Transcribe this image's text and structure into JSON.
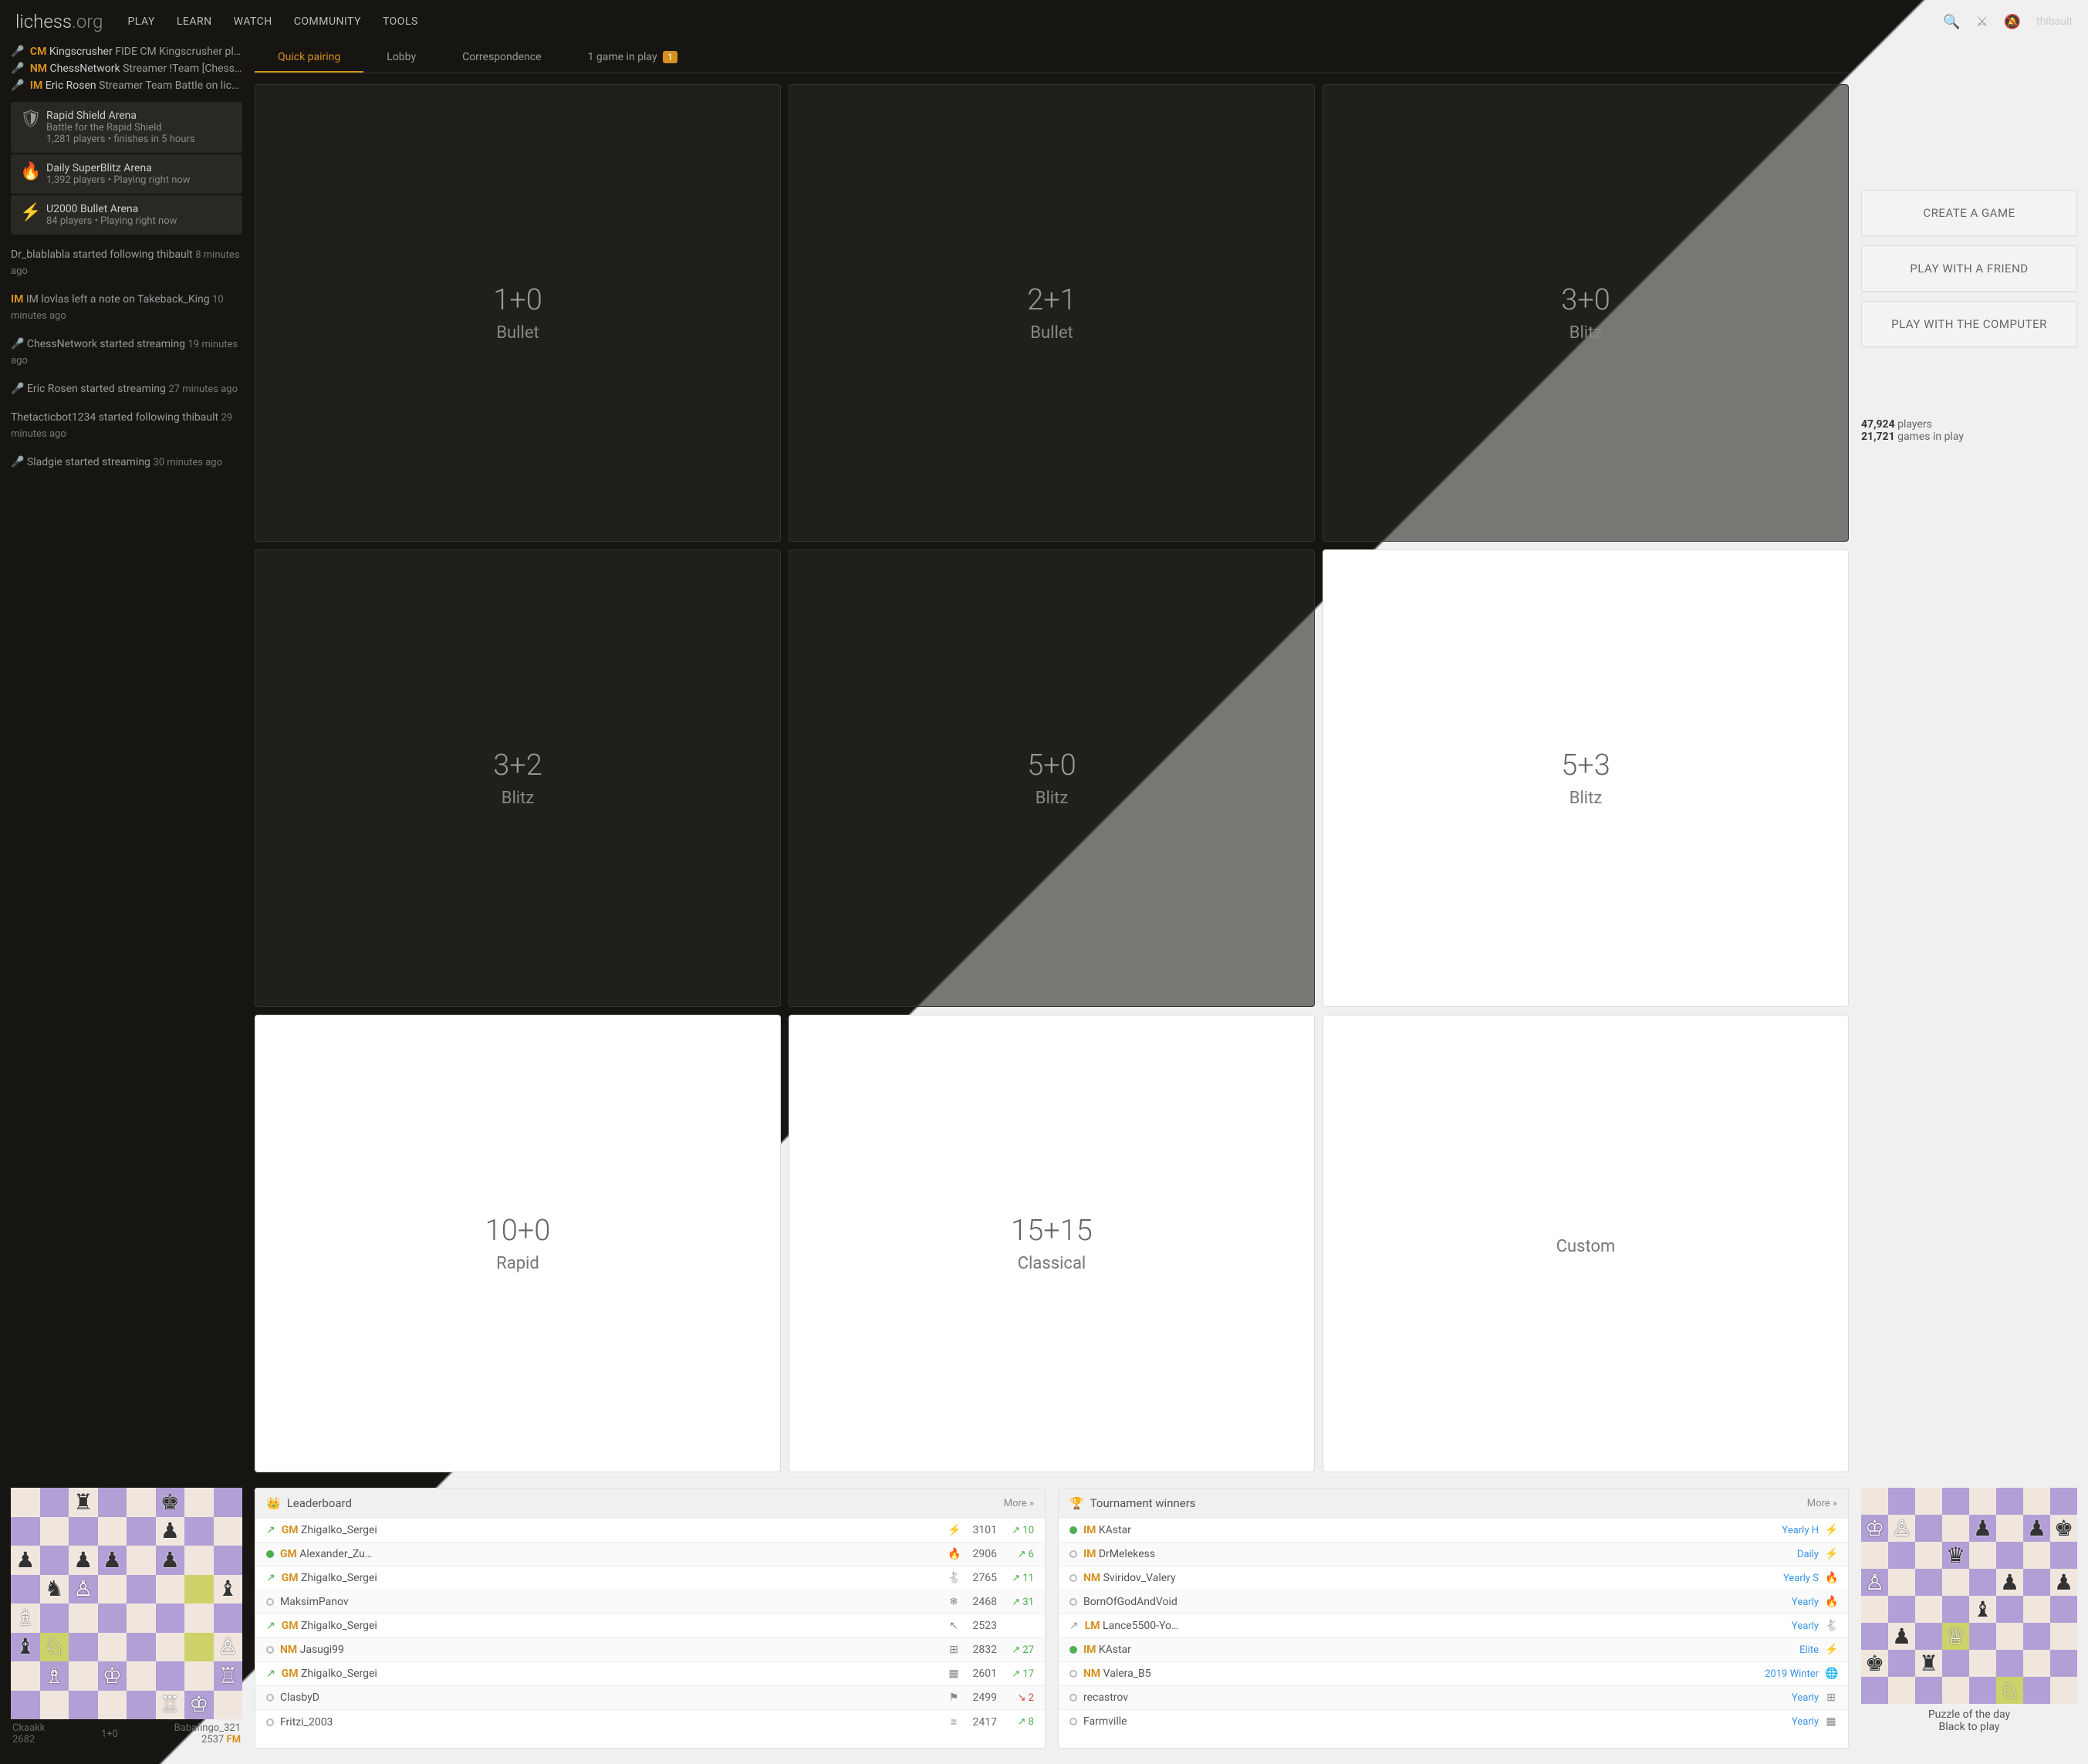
{
  "site": {
    "name": "lichess",
    "tld": ".org"
  },
  "nav": {
    "play": "PLAY",
    "learn": "LEARN",
    "watch": "WATCH",
    "community": "COMMUNITY",
    "tools": "TOOLS"
  },
  "user": {
    "name": "thibault"
  },
  "tabs": {
    "quick": "Quick pairing",
    "lobby": "Lobby",
    "corr": "Correspondence",
    "inplay_prefix": "1 game in play",
    "inplay_badge": "1"
  },
  "pairing": [
    {
      "time": "1+0",
      "label": "Bullet"
    },
    {
      "time": "2+1",
      "label": "Bullet"
    },
    {
      "time": "3+0",
      "label": "Blitz"
    },
    {
      "time": "3+2",
      "label": "Blitz"
    },
    {
      "time": "5+0",
      "label": "Blitz"
    },
    {
      "time": "5+3",
      "label": "Blitz"
    },
    {
      "time": "10+0",
      "label": "Rapid"
    },
    {
      "time": "15+15",
      "label": "Classical"
    },
    {
      "time": "",
      "label": "Custom"
    }
  ],
  "buttons": {
    "create": "CREATE A GAME",
    "friend": "PLAY WITH A FRIEND",
    "computer": "PLAY WITH THE COMPUTER"
  },
  "stats": {
    "players_n": "47,924",
    "players_label": " players",
    "games_n": "21,721",
    "games_label": " games in play"
  },
  "streamers": [
    {
      "title": "CM",
      "name": "Kingscrusher",
      "suffix": " FIDE CM Kingscrusher pla…"
    },
    {
      "title": "NM",
      "name": "ChessNetwork",
      "suffix": " Streamer !Team [Chess…"
    },
    {
      "title": "IM",
      "name": "Eric Rosen",
      "suffix": " Streamer Team Battle on liche…"
    }
  ],
  "arenas": [
    {
      "icon": "🛡",
      "name": "Rapid Shield Arena",
      "sub1": "Battle for the Rapid Shield",
      "sub2": "1,281 players • finishes  in 5 hours"
    },
    {
      "icon": "🔥",
      "name": "Daily SuperBlitz Arena",
      "sub1": "1,392 players • Playing right now",
      "sub2": ""
    },
    {
      "icon": "⚡",
      "name": "U2000 Bullet Arena",
      "sub1": "84 players • Playing right now",
      "sub2": ""
    }
  ],
  "feed": [
    {
      "html": "Dr_blablabla started following thibault",
      "time": "8 minutes ago"
    },
    {
      "html": "IM lovlas left a note on Takeback_King",
      "time": "10 minutes ago",
      "title": "IM"
    },
    {
      "html": "🎤 ChessNetwork started streaming",
      "time": "19 minutes ago"
    },
    {
      "html": "🎤 Eric Rosen started streaming",
      "time": "27 minutes ago"
    },
    {
      "html": "Thetacticbot1234 started following thibault",
      "time": "29 minutes ago"
    },
    {
      "html": "🎤 Sladgie started streaming",
      "time": "30 minutes ago"
    }
  ],
  "leaderboard": {
    "title": "Leaderboard",
    "more": "More »",
    "rows": [
      {
        "status": "away",
        "title": "GM",
        "name": "Zhigalko_Sergei",
        "icon": "⚡",
        "rating": "3101",
        "delta": "10",
        "dir": "up"
      },
      {
        "status": "online",
        "title": "GM",
        "name": "Alexander_Zu…",
        "icon": "🔥",
        "rating": "2906",
        "delta": "6",
        "dir": "up"
      },
      {
        "status": "away",
        "title": "GM",
        "name": "Zhigalko_Sergei",
        "icon": "🐇",
        "rating": "2765",
        "delta": "11",
        "dir": "up"
      },
      {
        "status": "offline",
        "title": "",
        "name": "MaksimPanov",
        "icon": "❄",
        "rating": "2468",
        "delta": "31",
        "dir": "up"
      },
      {
        "status": "away",
        "title": "GM",
        "name": "Zhigalko_Sergei",
        "icon": "↖",
        "rating": "2523",
        "delta": "",
        "dir": ""
      },
      {
        "status": "offline",
        "title": "NM",
        "name": "Jasugi99",
        "icon": "⊞",
        "rating": "2832",
        "delta": "27",
        "dir": "up"
      },
      {
        "status": "away",
        "title": "GM",
        "name": "Zhigalko_Sergei",
        "icon": "▦",
        "rating": "2601",
        "delta": "17",
        "dir": "up"
      },
      {
        "status": "offline",
        "title": "",
        "name": "ClasbyD",
        "icon": "⚑",
        "rating": "2499",
        "delta": "2",
        "dir": "down"
      },
      {
        "status": "offline",
        "title": "",
        "name": "Fritzi_2003",
        "icon": "≡",
        "rating": "2417",
        "delta": "8",
        "dir": "up"
      }
    ]
  },
  "winners": {
    "title": "Tournament winners",
    "more": "More »",
    "rows": [
      {
        "status": "online",
        "title": "IM",
        "name": "KAstar",
        "tourn": "Yearly H",
        "icon": "⚡"
      },
      {
        "status": "offline",
        "title": "IM",
        "name": "DrMelekess",
        "tourn": "Daily",
        "icon": "⚡"
      },
      {
        "status": "offline",
        "title": "NM",
        "name": "Sviridov_Valery",
        "tourn": "Yearly S",
        "icon": "🔥"
      },
      {
        "status": "offline",
        "title": "",
        "name": "BornOfGodAndVoid",
        "tourn": "Yearly",
        "icon": "🔥"
      },
      {
        "status": "away",
        "title": "LM",
        "name": "Lance5500-Yo…",
        "tourn": "Yearly",
        "icon": "🐇"
      },
      {
        "status": "online",
        "title": "IM",
        "name": "KAstar",
        "tourn": "Elite",
        "icon": "⚡"
      },
      {
        "status": "offline",
        "title": "NM",
        "name": "Valera_B5",
        "tourn": "2019 Winter",
        "icon": "🌐"
      },
      {
        "status": "offline",
        "title": "",
        "name": "recastrov",
        "tourn": "Yearly",
        "icon": "⊞"
      },
      {
        "status": "offline",
        "title": "",
        "name": "Farmville",
        "tourn": "Yearly",
        "icon": "▦"
      }
    ]
  },
  "tv": {
    "white": "Ckaakk",
    "white_rating": "2682",
    "time": "1+0",
    "black": "Babafingo_321",
    "black_rating": "2537",
    "black_title": "FM"
  },
  "puzzle": {
    "line1": "Puzzle of the day",
    "line2": "Black to play"
  }
}
